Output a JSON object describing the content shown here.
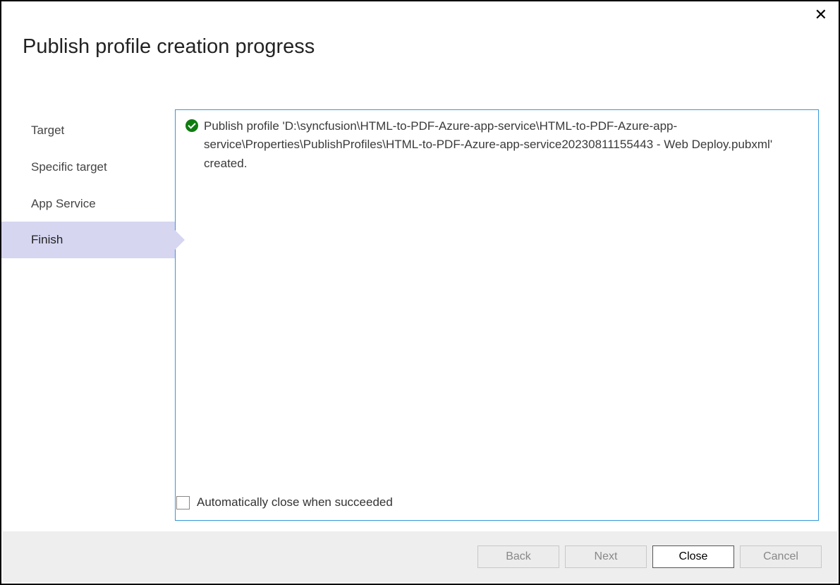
{
  "title": "Publish profile creation progress",
  "steps": [
    {
      "label": "Target",
      "selected": false
    },
    {
      "label": "Specific target",
      "selected": false
    },
    {
      "label": "App Service",
      "selected": false
    },
    {
      "label": "Finish",
      "selected": true
    }
  ],
  "message": {
    "text": "Publish profile 'D:\\syncfusion\\HTML-to-PDF-Azure-app-service\\HTML-to-PDF-Azure-app-service\\Properties\\PublishProfiles\\HTML-to-PDF-Azure-app-service20230811155443 - Web Deploy.pubxml' created."
  },
  "autoClose": {
    "label": "Automatically close when succeeded",
    "checked": false
  },
  "buttons": {
    "back": "Back",
    "next": "Next",
    "close": "Close",
    "cancel": "Cancel"
  }
}
